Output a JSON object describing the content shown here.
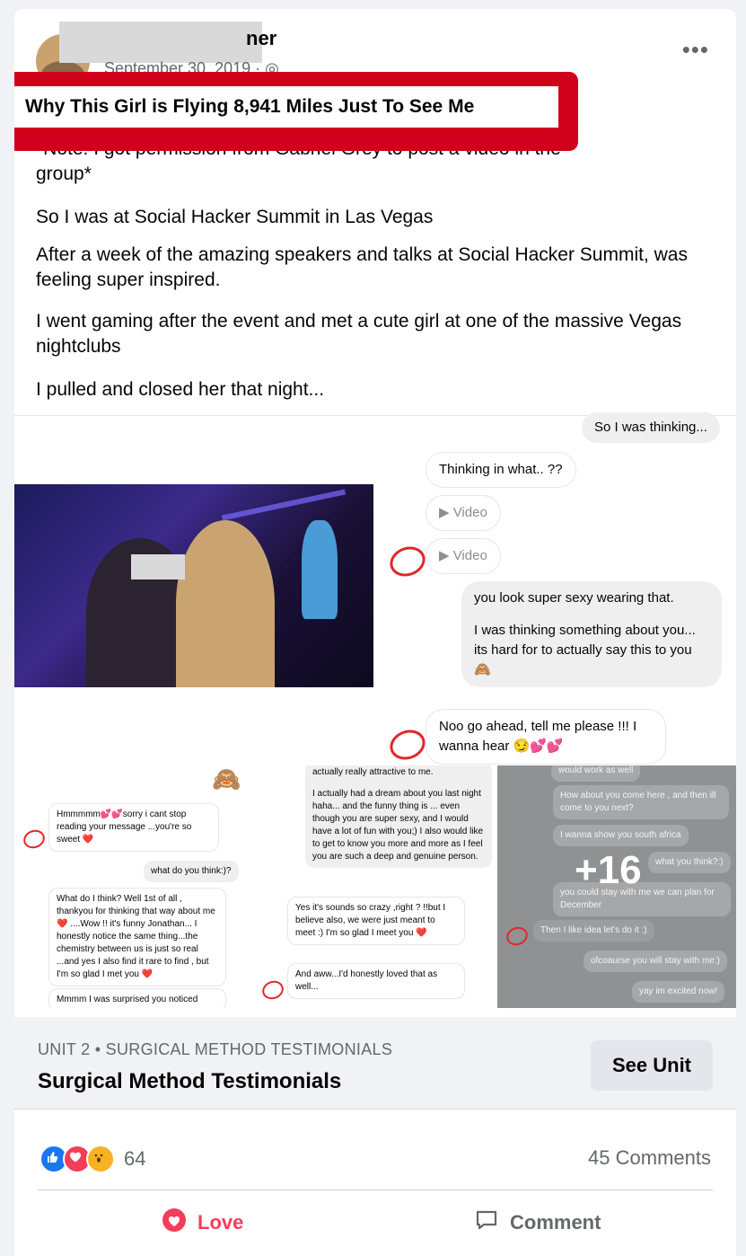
{
  "post": {
    "author_suffix": "ner",
    "date": "September 30, 2019 · ◎",
    "more": "•••",
    "headline": "Why This Girl is Flying 8,941 Miles Just To See Me",
    "partial_line": "*Note: I got permission from Gabriel Grey to post a video in the",
    "paragraph_1_end": "group*",
    "paragraph_2": "So I was at Social Hacker Summit in Las Vegas",
    "paragraph_3": "After a week of the amazing speakers and talks at Social Hacker Summit, was feeling super inspired.",
    "paragraph_4": "I went gaming after the event and met a cute girl at one of the massive Vegas nightclubs",
    "paragraph_5": "I pulled and closed her that night..."
  },
  "chat_main": {
    "m1": "So I was thinking...",
    "m2": "Thinking in what.. ??",
    "m3": "▶ Video",
    "m4": "▶ Video",
    "m5a": "you look super sexy wearing that.",
    "m5b": "I was thinking something about you... its hard for to actually say this to you 🙈",
    "m6": "Noo go ahead,  tell me please !!! I wanna hear 😏💕💕"
  },
  "thumb1": {
    "t1": "Hmmmmm💕💕sorry i cant stop reading your message ...you're so sweet ❤️",
    "t2": "what do you think:)?",
    "t3": "What do I think? Well 1st of all , thankyou for thinking that way about me ❤️ ....Wow !! it's funny Jonathan... I honestly notice the same thing...the chemistry between us is just so real ...and yes I also find it rare to find , but I'm so glad I met you ❤️",
    "t4": "Mmmm I was surprised you noticed"
  },
  "thumb2": {
    "t1": "actually really attractive to me.",
    "t2": "I actually had a dream about you last night haha... and the funny thing is ... even though you are super sexy, and I would have a lot of fun with you;) I also would like to get to know you more and more as I feel you are such a deep and genuine person.",
    "t3": "Yes it's sounds so crazy ,right ? !!but I believe also, we were just meant to meet :) I'm so glad I meet you ❤️",
    "t4": "And aww...I'd honestly loved that as well..."
  },
  "thumb3": {
    "t0": "would work as well",
    "t1": "How about you come here , and then ill come to you next?",
    "t2": "I wanna show you south africa",
    "t3": "what you think?:)",
    "t4": "you could stay with me we can plan for December",
    "t5": "Then I like idea let's do it :)",
    "t6": "ofcoaurse you will stay with me:)",
    "t7": "yay im excited now!",
    "more_count": "+16"
  },
  "unit": {
    "label": "UNIT 2 • SURGICAL METHOD TESTIMONIALS",
    "title": "Surgical Method Testimonials",
    "button": "See Unit"
  },
  "footer": {
    "reaction_count": "64",
    "comments": "45 Comments",
    "love": "Love",
    "comment": "Comment"
  },
  "colors": {
    "highlight_box": "#d0011b",
    "love": "#f33e58",
    "like": "#1877f2"
  }
}
